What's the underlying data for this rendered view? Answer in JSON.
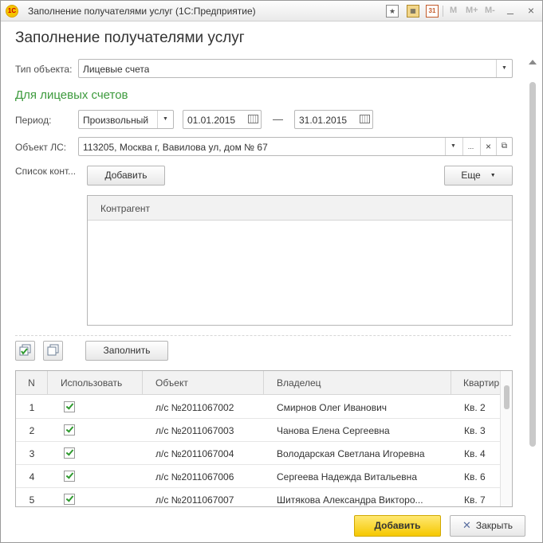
{
  "window": {
    "title": "Заполнение получателями услуг  (1С:Предприятие)",
    "app_icon_text": "1С",
    "toolbar": {
      "memory_buttons": [
        "M",
        "M+",
        "M-"
      ],
      "icons": [
        "bookmark-icon",
        "calculator-icon",
        "calendar-icon"
      ],
      "calendar_day": "31",
      "controls": [
        "minimize",
        "restore",
        "close"
      ]
    }
  },
  "form": {
    "heading": "Заполнение получателями услуг",
    "object_type": {
      "label": "Тип объекта:",
      "value": "Лицевые счета"
    },
    "section_title": "Для лицевых счетов",
    "period": {
      "label": "Период:",
      "kind": "Произвольный",
      "from": "01.01.2015",
      "dash": "—",
      "to": "31.01.2015"
    },
    "account_object": {
      "label": "Объект ЛС:",
      "value": "113205, Москва г, Вавилова ул, дом № 67",
      "ellipsis_button": "...",
      "clear_button": "×"
    },
    "contractors": {
      "label": "Список конт...",
      "add_button": "Добавить",
      "more_button": "Еще",
      "column": "Контрагент"
    },
    "fill_button": "Заполнить",
    "table": {
      "columns": [
        "N",
        "Использовать",
        "Объект",
        "Владелец",
        "Квартир"
      ],
      "rows": [
        {
          "n": "1",
          "use": true,
          "object": "л/с №2011067002",
          "owner": "Смирнов Олег Иванович",
          "apartment": "Кв. 2"
        },
        {
          "n": "2",
          "use": true,
          "object": "л/с №2011067003",
          "owner": "Чанова Елена Сергеевна",
          "apartment": "Кв. 3"
        },
        {
          "n": "3",
          "use": true,
          "object": "л/с №2011067004",
          "owner": "Володарская Светлана Игоревна",
          "apartment": "Кв. 4"
        },
        {
          "n": "4",
          "use": true,
          "object": "л/с №2011067006",
          "owner": "Сергеева Надежда Витальевна",
          "apartment": "Кв. 6"
        },
        {
          "n": "5",
          "use": true,
          "object": "л/с №2011067007",
          "owner": "Шитякова Александра Викторо...",
          "apartment": "Кв. 7"
        }
      ]
    },
    "footer": {
      "add_button": "Добавить",
      "close_button": "Закрыть"
    }
  },
  "colors": {
    "accent_green": "#3c9a3c",
    "primary_button": "#f5c800",
    "check_green": "#2f9a2f"
  }
}
